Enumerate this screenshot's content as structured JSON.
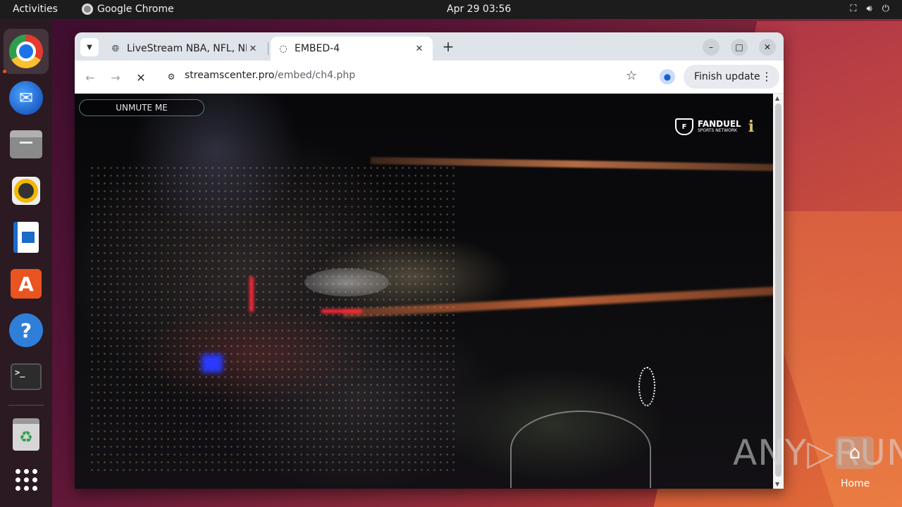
{
  "topbar": {
    "activities": "Activities",
    "app_name": "Google Chrome",
    "clock": "Apr 29  03:56",
    "tray_icons": [
      "network-icon",
      "volume-icon",
      "power-icon"
    ]
  },
  "dock": {
    "items": [
      "Google Chrome",
      "Thunderbird Mail",
      "Files",
      "Rhythmbox",
      "LibreOffice Writer",
      "Ubuntu Software",
      "Help",
      "Terminal",
      "Trash",
      "Show Applications"
    ],
    "terminal_glyph": ">_"
  },
  "browser": {
    "tabs": [
      {
        "title": "LiveStream NBA, NFL, NHL",
        "active": false,
        "favicon": "globe-icon"
      },
      {
        "title": "EMBED-4",
        "active": true,
        "favicon": "loading-icon"
      }
    ],
    "new_tab": "+",
    "url_host": "streamscenter.pro",
    "url_path": "/embed/ch4.php",
    "finish_update": "Finish update"
  },
  "video": {
    "unmute_label": "UNMUTE ME",
    "brand_line1": "FANDUEL",
    "brand_line2": "SPORTS NETWORK"
  },
  "desktop": {
    "watermark": "ANY▷RUN",
    "home_label": "Home"
  },
  "colors": {
    "accent": "#e95420",
    "topbar": "#1c1c1c"
  }
}
